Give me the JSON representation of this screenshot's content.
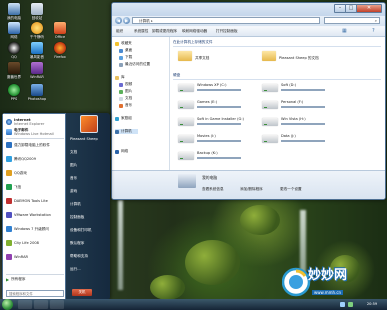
{
  "explorer": {
    "address_segments": [
      "计算机"
    ],
    "toolbar": {
      "organize": "组织",
      "system_properties": "系统属性",
      "uninstall": "卸载或更改程序",
      "map_drive": "映射网络驱动器",
      "control_panel": "打开控制面板"
    },
    "nav": {
      "favorites": "收藏夹",
      "desktop": "桌面",
      "downloads": "下载",
      "recent": "最近访问的位置",
      "libraries": "库",
      "videos": "视频",
      "pictures": "图片",
      "documents": "文档",
      "music": "音乐",
      "homegroup": "家庭组",
      "computer": "计算机",
      "network": "网络"
    },
    "groups": {
      "stored_files": "在此计算机上存储的文件",
      "drives": "硬盘"
    },
    "stored_folders": [
      {
        "name": "共享文档"
      },
      {
        "name": "Pleasant Sheep 的文档"
      }
    ],
    "drives": [
      {
        "name": "Windows XP (C:)",
        "used_fraction": 0.35
      },
      {
        "name": "Soft (D:)",
        "used_fraction": 0.55
      },
      {
        "name": "Games (E:)",
        "used_fraction": 0.4
      },
      {
        "name": "Personal (F:)",
        "used_fraction": 0.3
      },
      {
        "name": "Soft in Game Installer (G:)",
        "used_fraction": 0.6
      },
      {
        "name": "Win Vista (H:)",
        "used_fraction": 0.45
      },
      {
        "name": "Movies (I:)",
        "used_fraction": 0.5
      },
      {
        "name": "Data (J:)",
        "used_fraction": 0.35
      },
      {
        "name": "Backup (K:)",
        "used_fraction": 0.25
      }
    ],
    "details": {
      "computer_label": "我的电脑",
      "action_view": "查看系统信息",
      "action_addremove": "添加/删除程序",
      "action_control": "更改一个设置"
    }
  },
  "start_menu": {
    "pinned": [
      {
        "label": "Internet",
        "sub": "Internet Explorer"
      },
      {
        "label": "电子邮件",
        "sub": "Windows Live Hotmail"
      }
    ],
    "recent": [
      {
        "label": "强力卸载电脑上的软件"
      },
      {
        "label": "腾讯QQ2009"
      },
      {
        "label": "QQ游戏"
      },
      {
        "label": "飞信"
      },
      {
        "label": "DAEMON Tools Lite"
      },
      {
        "label": "VMware Workstation"
      },
      {
        "label": "Windows 7 升级顾问"
      },
      {
        "label": "City Life 2008"
      },
      {
        "label": "WinRAR"
      }
    ],
    "all_programs": "所有程序",
    "search_placeholder": "搜索程序和文件",
    "right": [
      "Pleasant Sheep",
      "文档",
      "图片",
      "音乐",
      "游戏",
      "计算机",
      "控制面板",
      "设备和打印机",
      "默认程序",
      "帮助和支持",
      "运行..."
    ],
    "shutdown": "关机"
  },
  "desktop_icons": [
    {
      "label": "我的电脑"
    },
    {
      "label": "回收站"
    },
    {
      "label": "网络"
    },
    {
      "label": "千千静听"
    },
    {
      "label": "Office"
    },
    {
      "label": "QQ"
    },
    {
      "label": "暴风影音"
    },
    {
      "label": "Firefox"
    },
    {
      "label": "魔兽世界"
    },
    {
      "label": "WinRAR"
    },
    {
      "label": "PPS"
    },
    {
      "label": "Photoshop"
    }
  ],
  "taskbar": {
    "clock": "20:59"
  },
  "watermark": {
    "text": "妙妙网",
    "url": "www.mmh.cn"
  }
}
